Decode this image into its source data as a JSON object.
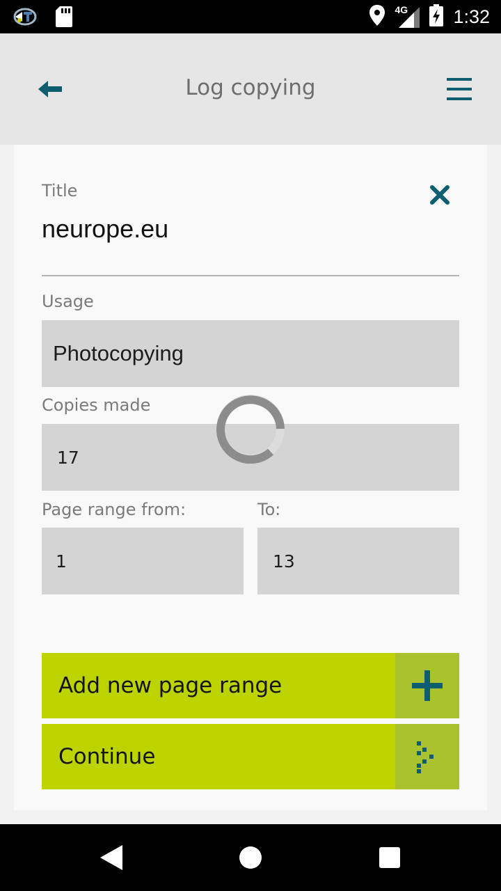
{
  "status_bar": {
    "time": "1:32",
    "network": "4G",
    "icons": [
      "app-notification-icon",
      "sd-card-icon",
      "location-icon",
      "signal-icon",
      "battery-charging-icon"
    ]
  },
  "header": {
    "title": "Log copying",
    "back_icon": "back-arrow-icon",
    "menu_icon": "hamburger-menu-icon",
    "accent_color": "#0e5e6f"
  },
  "form": {
    "title_label": "Title",
    "title_value": "neurope.eu",
    "usage_label": "Usage",
    "usage_value": "Photocopying",
    "copies_label": "Copies made",
    "copies_value": "17",
    "range_from_label": "Page range from:",
    "range_from_value": "1",
    "range_to_label": "To:",
    "range_to_value": "13"
  },
  "buttons": {
    "add_range_label": "Add new page range",
    "continue_label": "Continue",
    "button_color": "#bcd300"
  },
  "loading": {
    "spinner_visible": true
  },
  "nav_bar": {
    "icons": [
      "nav-back-icon",
      "nav-home-icon",
      "nav-recents-icon"
    ]
  }
}
